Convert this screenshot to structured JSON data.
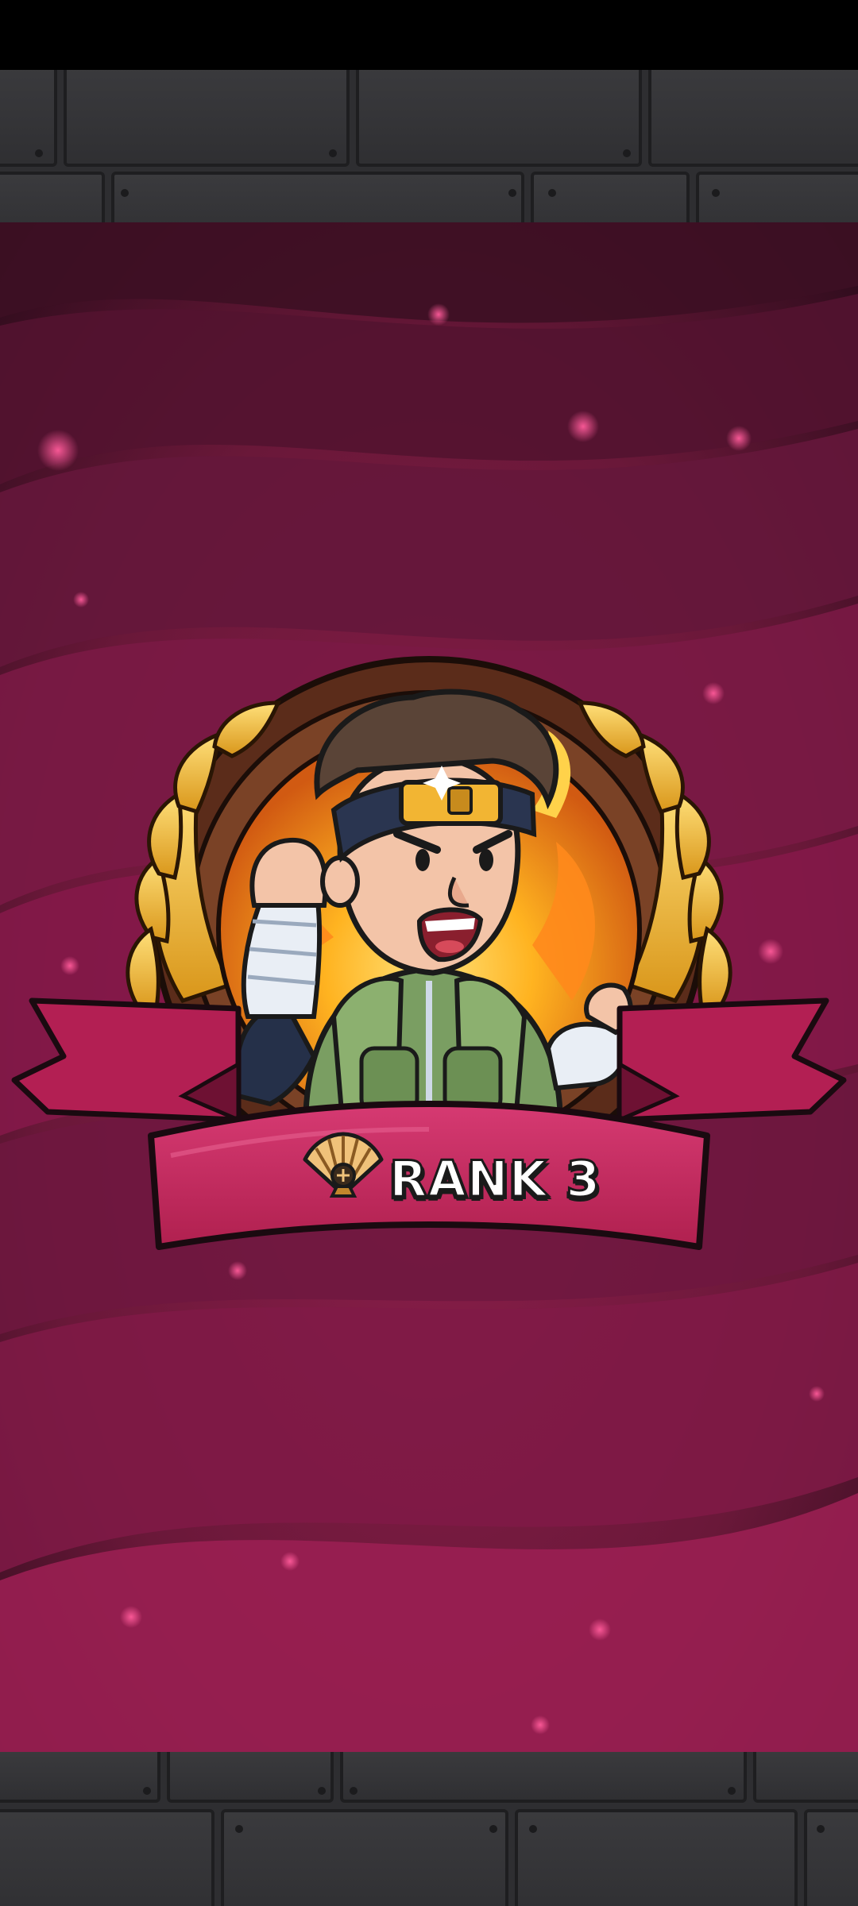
{
  "rank": {
    "label": "RANK 3",
    "emblem_icon": "folding-fan-icon"
  },
  "character": {
    "icon": "ninja-character-icon"
  },
  "colors": {
    "background_dark": "#4a1530",
    "background_light": "#8a1c48",
    "ribbon": "#c42a62",
    "laurel_gold": "#e9b227",
    "stone": "#2e2e31"
  }
}
